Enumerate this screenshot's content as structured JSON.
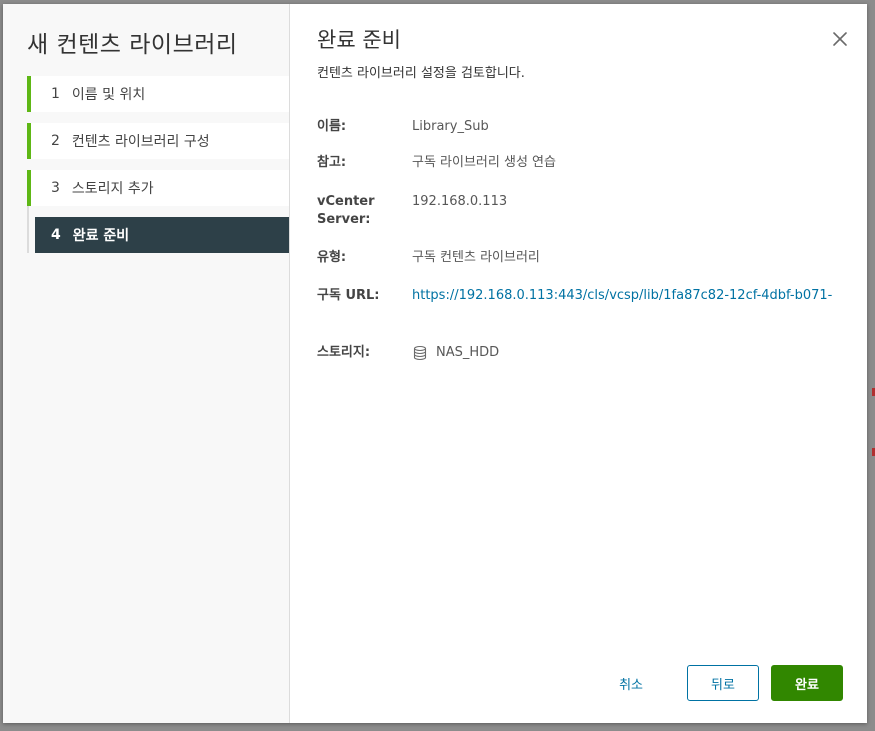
{
  "dialog": {
    "title": "새 컨텐츠 라이브러리"
  },
  "steps": [
    {
      "num": "1",
      "label": "이름 및 위치",
      "state": "completed"
    },
    {
      "num": "2",
      "label": "컨텐츠 라이브러리 구성",
      "state": "completed"
    },
    {
      "num": "3",
      "label": "스토리지 추가",
      "state": "completed"
    },
    {
      "num": "4",
      "label": "완료 준비",
      "state": "active"
    }
  ],
  "page": {
    "title": "완료 준비",
    "subtitle": "컨텐츠 라이브러리 설정을 검토합니다."
  },
  "summary": {
    "name_label": "이름:",
    "name_value": "Library_Sub",
    "notes_label": "참고:",
    "notes_value": "구독 라이브러리 생성 연습",
    "vcenter_label_1": "vCenter",
    "vcenter_label_2": "Server:",
    "vcenter_value": "192.168.0.113",
    "type_label": "유형:",
    "type_value": "구독 컨텐츠 라이브러리",
    "url_label": "구독 URL:",
    "url_value": "https://192.168.0.113:443/cls/vcsp/lib/1fa87c82-12cf-4dbf-b071-",
    "storage_label": "스토리지:",
    "storage_value": "NAS_HDD",
    "storage_icon": "datastore-icon"
  },
  "footer": {
    "cancel_label": "취소",
    "back_label": "뒤로",
    "finish_label": "완료"
  },
  "colors": {
    "step_complete": "#5eb715",
    "step_active_bg": "#2d4048",
    "link": "#0072a3",
    "primary_button": "#318700"
  }
}
